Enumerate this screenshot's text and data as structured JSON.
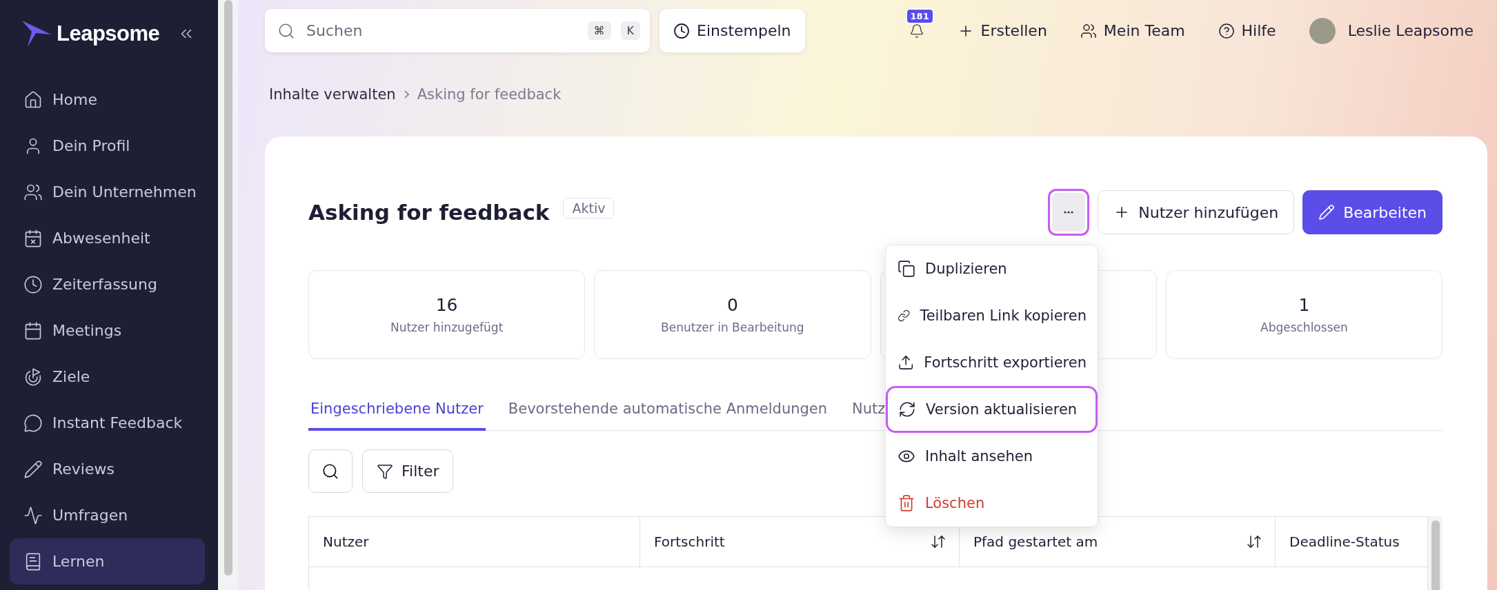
{
  "sidebar": {
    "logo": "Leapsome",
    "items": [
      {
        "label": "Home",
        "selected": false
      },
      {
        "label": "Dein Profil",
        "selected": false
      },
      {
        "label": "Dein Unternehmen",
        "selected": false
      },
      {
        "label": "Abwesenheit",
        "selected": false
      },
      {
        "label": "Zeiterfassung",
        "selected": false
      },
      {
        "label": "Meetings",
        "selected": false
      },
      {
        "label": "Ziele",
        "selected": false
      },
      {
        "label": "Instant Feedback",
        "selected": false
      },
      {
        "label": "Reviews",
        "selected": false
      },
      {
        "label": "Umfragen",
        "selected": false
      },
      {
        "label": "Lernen",
        "selected": true
      }
    ]
  },
  "topbar": {
    "search": {
      "placeholder": "Suchen",
      "keys": [
        "⌘",
        "K"
      ]
    },
    "clock_button": "Einstempeln",
    "notifications": "181",
    "actions": [
      "Erstellen",
      "Mein Team",
      "Hilfe"
    ],
    "user": "Leslie Leapsome"
  },
  "breadcrumb": [
    "Inhalte verwalten",
    "Asking for feedback"
  ],
  "page": {
    "title": "Asking for feedback",
    "status": "Aktiv",
    "more_button": {
      "highlighted": true
    },
    "buttons": [
      {
        "label": "Nutzer hinzufügen",
        "kind": "secondary"
      },
      {
        "label": "Bearbeiten",
        "kind": "primary"
      }
    ],
    "stats": [
      {
        "kind": "figure",
        "value": "16",
        "label": "Nutzer hinzugefügt"
      },
      {
        "kind": "figure",
        "value": "0",
        "label": "Benutzer in Bearbeitung"
      },
      {
        "kind": "covered"
      },
      {
        "kind": "figure",
        "value": "1",
        "label": "Abgeschlossen"
      }
    ],
    "tabs": [
      {
        "label": "Eingeschriebene Nutzer",
        "selected": true
      },
      {
        "label": "Bevorstehende automatische Anmeldungen",
        "selected": false
      },
      {
        "label": "Nutz",
        "selected": false
      }
    ],
    "filter_button": "Filter",
    "table": {
      "columns": [
        {
          "label": "Nutzer",
          "sortable": false
        },
        {
          "label": "Fortschritt",
          "sortable": true
        },
        {
          "label": "Pfad gestartet am",
          "sortable": true
        },
        {
          "label": "Deadline-Status",
          "sortable": false
        }
      ]
    },
    "menu": [
      {
        "label": "Duplizieren",
        "kind": "normal",
        "highlighted": false
      },
      {
        "label": "Teilbaren Link kopieren",
        "kind": "normal",
        "highlighted": false
      },
      {
        "label": "Fortschritt exportieren",
        "kind": "normal",
        "highlighted": false
      },
      {
        "label": "Version aktualisieren",
        "kind": "normal",
        "highlighted": true
      },
      {
        "label": "Inhalt ansehen",
        "kind": "normal",
        "highlighted": false
      },
      {
        "label": "Löschen",
        "kind": "danger",
        "highlighted": false
      }
    ]
  }
}
